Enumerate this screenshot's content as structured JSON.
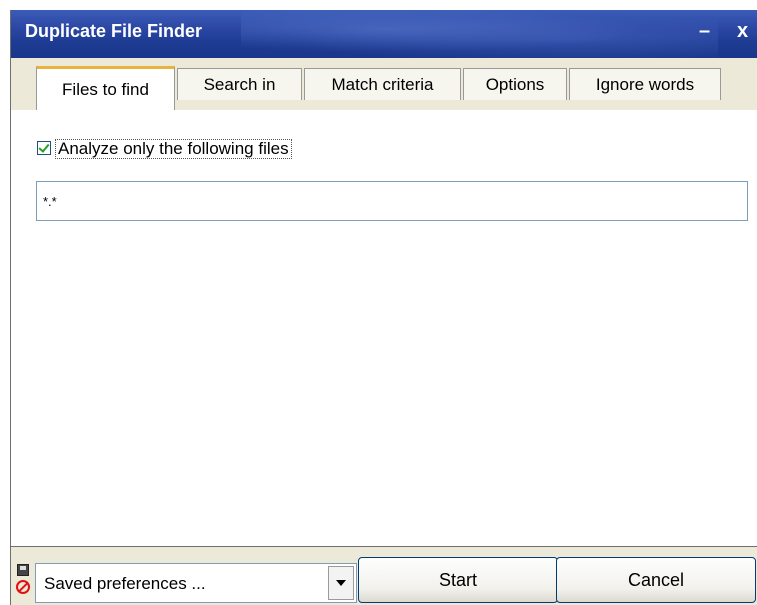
{
  "window": {
    "title": "Duplicate File Finder",
    "minimize_glyph": "–",
    "close_glyph": "x"
  },
  "tabs": [
    {
      "label": "Files to find",
      "active": true
    },
    {
      "label": "Search in",
      "active": false
    },
    {
      "label": "Match criteria",
      "active": false
    },
    {
      "label": "Options",
      "active": false
    },
    {
      "label": "Ignore words",
      "active": false
    }
  ],
  "files_to_find": {
    "checkbox_label": "Analyze only the following files",
    "checked": true,
    "filter_value": "*.*"
  },
  "bottom": {
    "preferences_value": "Saved preferences ...",
    "start_label": "Start",
    "cancel_label": "Cancel"
  },
  "icons": {
    "save": "floppy-disk-icon",
    "delete": "no-sign-icon",
    "dropdown": "chevron-down-icon"
  },
  "colors": {
    "titlebar": "#1d3b92",
    "active_tab_accent": "#e9b23c",
    "window_bg": "#ece9d8",
    "button_border": "#003c74"
  }
}
